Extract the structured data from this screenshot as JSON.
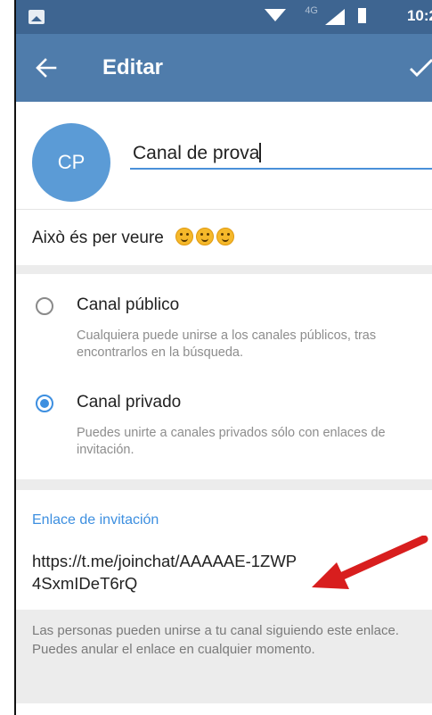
{
  "status_bar": {
    "network": "4G",
    "time": "10:2",
    "icons": [
      "image-icon",
      "wifi-icon",
      "signal-icon",
      "battery-icon"
    ]
  },
  "app_bar": {
    "title": "Editar",
    "back_icon": "back-arrow-icon",
    "confirm_icon": "check-icon",
    "color": "#4f7cab"
  },
  "channel": {
    "avatar_initials": "CP",
    "avatar_color": "#5b9bd6",
    "name_value": "Canal de prova",
    "description_text": "Això és per veure",
    "description_emojis": [
      "smile-emoji",
      "smile-emoji",
      "smile-emoji"
    ]
  },
  "channel_type": {
    "options": [
      {
        "label": "Canal público",
        "description": "Cualquiera puede unirse a los canales públicos, tras encontrarlos en la búsqueda.",
        "selected": false
      },
      {
        "label": "Canal privado",
        "description": "Puedes unirte a canales privados sólo con enlaces de invitación.",
        "selected": true
      }
    ]
  },
  "invite_link": {
    "header": "Enlace de invitación",
    "url": "https://t.me/joinchat/AAAAAE-1ZWP4SxmIDeT6rQ",
    "info": "Las personas pueden unirse a tu canal siguiendo este enlace. Puedes anular el enlace en cualquier momento."
  },
  "annotation": {
    "arrow_color": "#d81e1e"
  }
}
